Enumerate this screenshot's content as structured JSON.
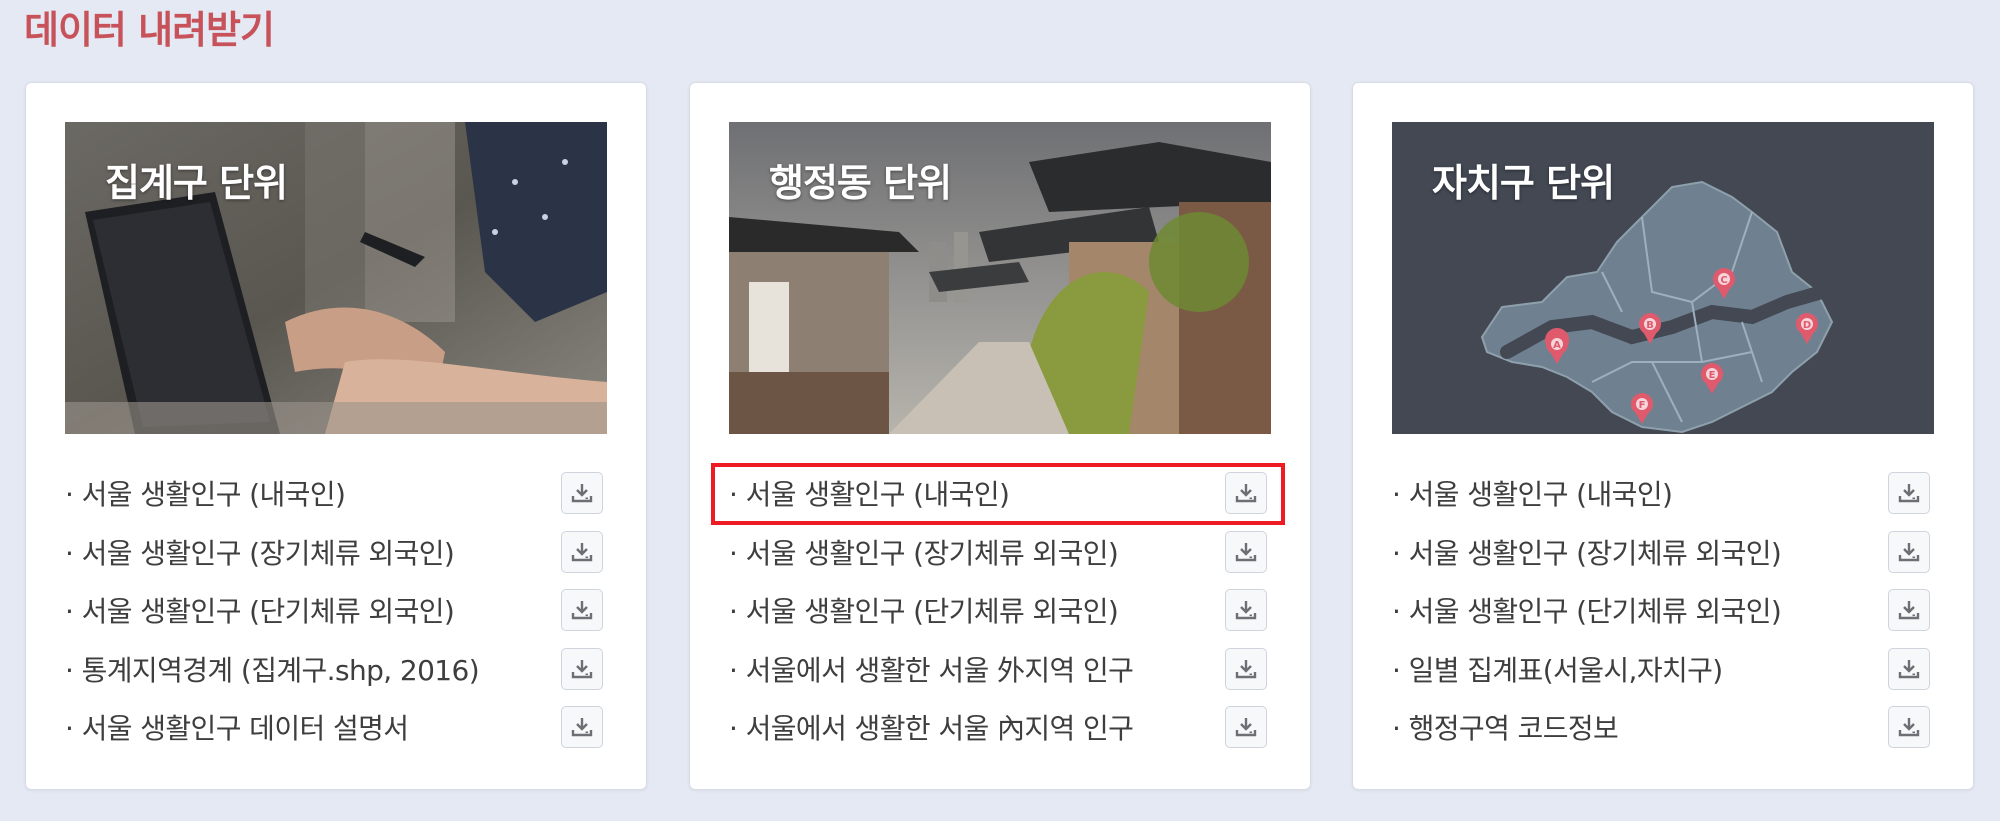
{
  "section_title": "데이터 내려받기",
  "colors": {
    "title_accent": "#c7525a",
    "page_bg": "#e4e9f3",
    "highlight": "#ee1b24",
    "map_fill": "#6f8190",
    "map_bg": "#434853",
    "map_pin": "#e05a6d"
  },
  "cards": [
    {
      "title": "집계구 단위",
      "image": "people-with-laptop-photo",
      "items": [
        {
          "label": "서울 생활인구 (내국인)",
          "icon": "download-icon"
        },
        {
          "label": "서울 생활인구 (장기체류 외국인)",
          "icon": "download-icon"
        },
        {
          "label": "서울 생활인구 (단기체류 외국인)",
          "icon": "download-icon"
        },
        {
          "label": "통계지역경계 (집계구.shp, 2016)",
          "icon": "download-icon"
        },
        {
          "label": "서울 생활인구 데이터 설명서",
          "icon": "download-icon"
        }
      ]
    },
    {
      "title": "행정동 단위",
      "image": "hanok-village-photo",
      "items": [
        {
          "label": "서울 생활인구 (내국인)",
          "icon": "download-icon",
          "highlighted": true
        },
        {
          "label": "서울 생활인구 (장기체류 외국인)",
          "icon": "download-icon"
        },
        {
          "label": "서울 생활인구 (단기체류 외국인)",
          "icon": "download-icon"
        },
        {
          "label": "서울에서 생활한 서울 外지역 인구",
          "icon": "download-icon"
        },
        {
          "label": "서울에서 생활한 서울 內지역 인구",
          "icon": "download-icon"
        }
      ]
    },
    {
      "title": "자치구 단위",
      "image": "seoul-district-map",
      "map_pins": [
        "A",
        "B",
        "C",
        "D",
        "E",
        "F"
      ],
      "items": [
        {
          "label": "서울 생활인구 (내국인)",
          "icon": "download-icon"
        },
        {
          "label": "서울 생활인구 (장기체류 외국인)",
          "icon": "download-icon"
        },
        {
          "label": "서울 생활인구 (단기체류 외국인)",
          "icon": "download-icon"
        },
        {
          "label": "일별 집계표(서울시,자치구)",
          "icon": "download-icon"
        },
        {
          "label": "행정구역 코드정보",
          "icon": "download-icon"
        }
      ]
    }
  ]
}
